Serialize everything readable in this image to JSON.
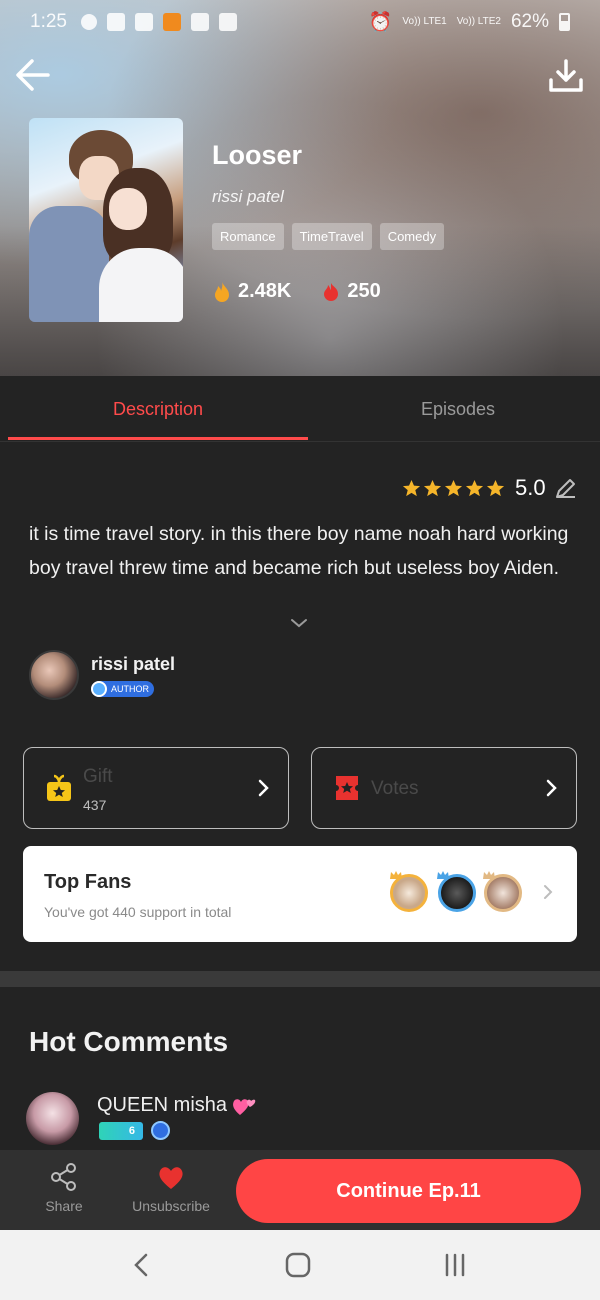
{
  "status_bar": {
    "time": "1:25",
    "network1": "Vo)) LTE1",
    "network2": "Vo)) LTE2",
    "battery": "62%"
  },
  "header": {
    "back_icon": "arrow-left-icon",
    "download_icon": "download-icon"
  },
  "book": {
    "title": "Looser",
    "author": "rissi patel",
    "tags": [
      "Romance",
      "TimeTravel",
      "Comedy"
    ],
    "views": "2.48K",
    "votes": "250"
  },
  "tabs": [
    {
      "label": "Description",
      "active": true
    },
    {
      "label": "Episodes",
      "active": false
    }
  ],
  "rating": {
    "value": "5.0",
    "stars": 5
  },
  "description": {
    "text": "it is time travel story. in this there boy name noah hard working boy travel threw time and became rich but useless boy Aiden."
  },
  "author_section": {
    "name": "rissi patel",
    "badge": "AUTHOR"
  },
  "cards": {
    "gift": {
      "title": "Gift",
      "count": "437"
    },
    "votes": {
      "title": "Votes"
    }
  },
  "top_fans": {
    "title": "Top Fans",
    "subtitle": "You've got 440 support in total"
  },
  "hot_comments": {
    "title": "Hot Comments",
    "first": {
      "name": "QUEEN misha",
      "level": "6"
    }
  },
  "bottom_bar": {
    "share_label": "Share",
    "unsubscribe_label": "Unsubscribe",
    "continue_label": "Continue Ep.11"
  },
  "colors": {
    "accent": "#ff4545",
    "background": "#232323"
  }
}
